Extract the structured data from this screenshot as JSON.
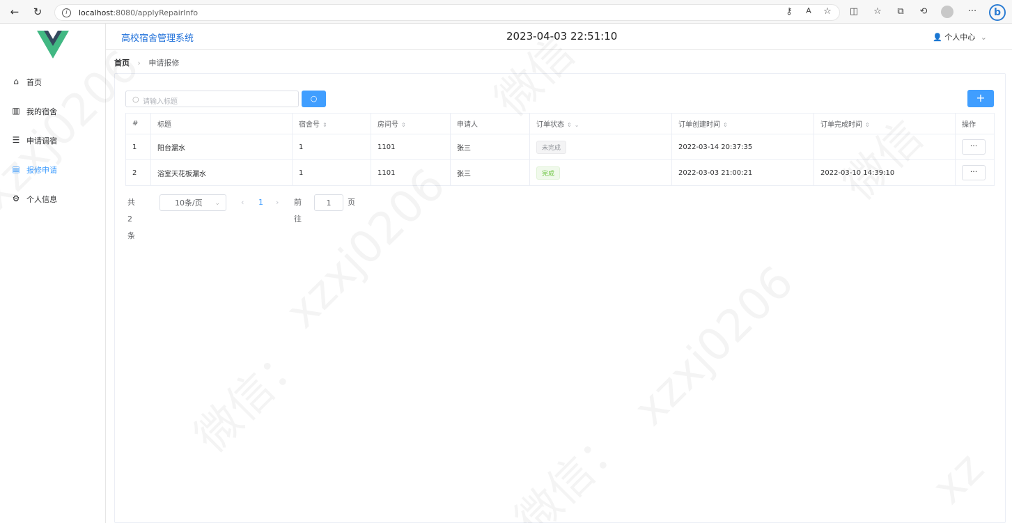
{
  "browser": {
    "url_host": "localhost",
    "url_rest": ":8080/applyRepairInfo"
  },
  "header": {
    "system_title": "高校宿舍管理系统",
    "clock": "2023-04-03 22:51:10",
    "user_center": "个人中心"
  },
  "sidebar": {
    "items": [
      {
        "label": "首页",
        "icon": "home-icon"
      },
      {
        "label": "我的宿舍",
        "icon": "building-icon"
      },
      {
        "label": "申请调宿",
        "icon": "archive-icon"
      },
      {
        "label": "报修申请",
        "icon": "document-icon"
      },
      {
        "label": "个人信息",
        "icon": "gear-icon"
      }
    ],
    "active_index": 3
  },
  "breadcrumb": {
    "home": "首页",
    "current": "申请报修"
  },
  "search": {
    "placeholder": "请输入标题"
  },
  "add_button": "+",
  "table": {
    "columns": [
      "#",
      "标题",
      "宿舍号",
      "房间号",
      "申请人",
      "订单状态",
      "订单创建时间",
      "订单完成时间",
      "操作"
    ],
    "rows": [
      {
        "index": "1",
        "title": "阳台漏水",
        "dorm": "1",
        "room": "1101",
        "applicant": "张三",
        "status": "未完成",
        "created": "2022-03-14 20:37:35",
        "finished": "",
        "op": "···"
      },
      {
        "index": "2",
        "title": "浴室天花板漏水",
        "dorm": "1",
        "room": "1101",
        "applicant": "张三",
        "status": "完成",
        "created": "2022-03-03 21:00:21",
        "finished": "2022-03-10 14:39:10",
        "op": "···"
      }
    ]
  },
  "pagination": {
    "total": "共 2 条",
    "page_size": "10条/页",
    "current_page": "1",
    "goto_label": "前往",
    "goto_value": "1",
    "page_suffix": "页"
  },
  "colors": {
    "primary": "#409eff",
    "logo_green": "#41b883",
    "logo_dark": "#34495e",
    "success": "#67c23a"
  }
}
